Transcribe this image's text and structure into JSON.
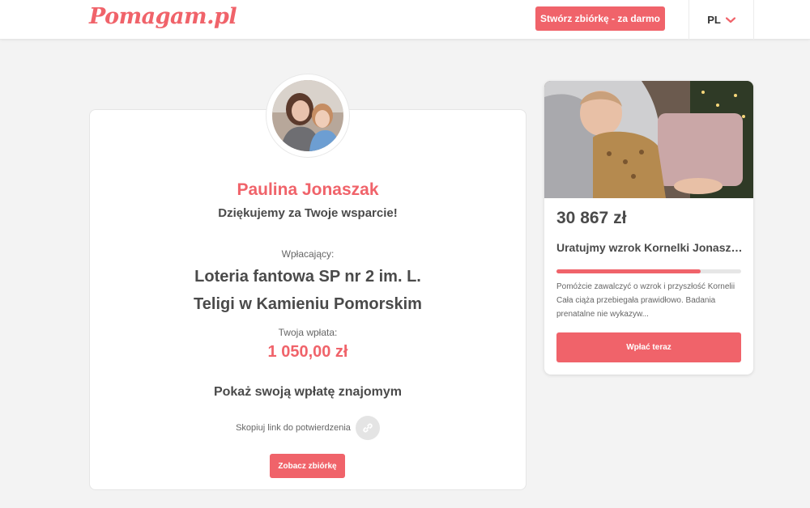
{
  "header": {
    "logo": "Pomagam.pl",
    "create_button": "Stwórz zbiórkę - za darmo",
    "language": "PL",
    "chevron_icon": "chevron-down-icon"
  },
  "confirmation": {
    "name": "Paulina Jonaszak",
    "thanks": "Dziękujemy za Twoje wsparcie!",
    "payer_label": "Wpłacający:",
    "payer_line1": "Loteria fantowa SP nr 2 im. L.",
    "payer_line2": "Teligi w Kamieniu Pomorskim",
    "amount_label": "Twoja wpłata:",
    "amount": "1 050,00 zł",
    "share_heading": "Pokaż swoją wpłatę znajomym",
    "copy_link_label": "Skopiuj link do potwierdzenia",
    "link_icon": "link-icon",
    "see_button": "Zobacz zbiórkę"
  },
  "campaign": {
    "amount": "30 867 zł",
    "title": "Uratujmy wzrok Kornelki Jonaszak",
    "progress_fraction": 0.78,
    "description": "Pomóżcie zawalczyć o wzrok i przyszłość Kornelii Cała ciąża przebiegała prawidłowo. Badania prenatalne nie wykazyw...",
    "pay_button": "Wpłać teraz"
  },
  "colors": {
    "accent": "#f0636a",
    "background": "#f3f3f3"
  }
}
